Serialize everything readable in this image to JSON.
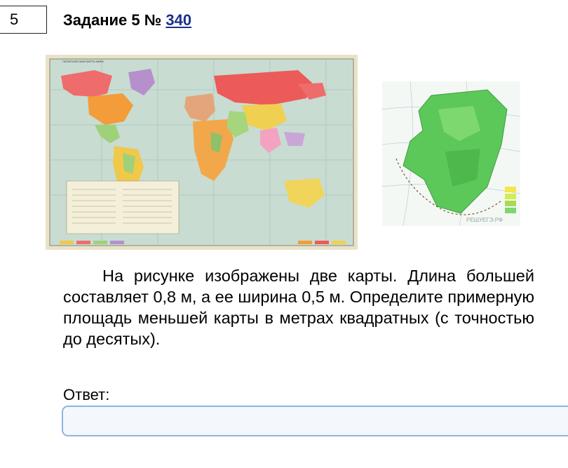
{
  "task": {
    "number": "5",
    "title_prefix": "Задание 5 № ",
    "id_link": "340"
  },
  "figures": {
    "world_map": {
      "header": "ПОЛИТИЧЕСКАЯ КАРТА МИРА"
    },
    "region_map": {
      "watermark": "РЕШУЕГЭ.РФ"
    }
  },
  "question": {
    "text": "На рисунке изображены две карты. Длина большей составляет 0,8 м, а ее ширина 0,5 м. Определите примерную площадь меньшей карты в метрах квадратных (с точностью до десятых)."
  },
  "answer": {
    "label": "Ответ:",
    "value": "",
    "placeholder": ""
  },
  "colors": {
    "link": "#1c2f8c",
    "input_border": "#8fb3e3",
    "input_bg": "#f4f7fc",
    "map_ocean": "#c8dcd2",
    "region_green": "#5cc85a"
  }
}
